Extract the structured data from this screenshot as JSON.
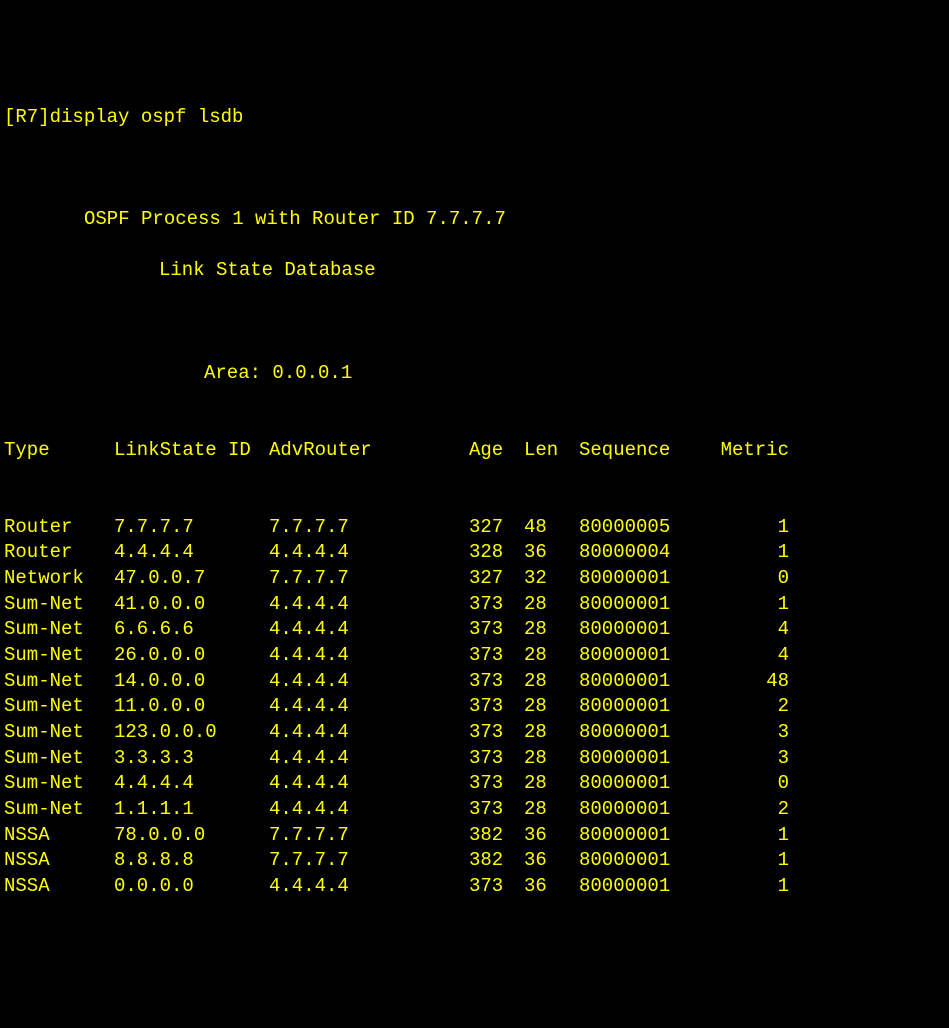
{
  "prompt_line": "[R7]display ospf lsdb",
  "header": {
    "process_line": "OSPF Process 1 with Router ID 7.7.7.7",
    "subtitle": "Link State Database"
  },
  "area_label": "Area: 0.0.0.1",
  "columns": {
    "type": "Type",
    "lsid": "LinkState ID",
    "adv": "AdvRouter",
    "age": "Age",
    "len": "Len",
    "seq": "Sequence",
    "metric": "Metric"
  },
  "rows": [
    {
      "type": "Router",
      "lsid": "7.7.7.7",
      "adv": "7.7.7.7",
      "age": "327",
      "len": "48",
      "seq": "80000005",
      "metric": "1"
    },
    {
      "type": "Router",
      "lsid": "4.4.4.4",
      "adv": "4.4.4.4",
      "age": "328",
      "len": "36",
      "seq": "80000004",
      "metric": "1"
    },
    {
      "type": "Network",
      "lsid": "47.0.0.7",
      "adv": "7.7.7.7",
      "age": "327",
      "len": "32",
      "seq": "80000001",
      "metric": "0"
    },
    {
      "type": "Sum-Net",
      "lsid": "41.0.0.0",
      "adv": "4.4.4.4",
      "age": "373",
      "len": "28",
      "seq": "80000001",
      "metric": "1"
    },
    {
      "type": "Sum-Net",
      "lsid": "6.6.6.6",
      "adv": "4.4.4.4",
      "age": "373",
      "len": "28",
      "seq": "80000001",
      "metric": "4"
    },
    {
      "type": "Sum-Net",
      "lsid": "26.0.0.0",
      "adv": "4.4.4.4",
      "age": "373",
      "len": "28",
      "seq": "80000001",
      "metric": "4"
    },
    {
      "type": "Sum-Net",
      "lsid": "14.0.0.0",
      "adv": "4.4.4.4",
      "age": "373",
      "len": "28",
      "seq": "80000001",
      "metric": "48"
    },
    {
      "type": "Sum-Net",
      "lsid": "11.0.0.0",
      "adv": "4.4.4.4",
      "age": "373",
      "len": "28",
      "seq": "80000001",
      "metric": "2"
    },
    {
      "type": "Sum-Net",
      "lsid": "123.0.0.0",
      "adv": "4.4.4.4",
      "age": "373",
      "len": "28",
      "seq": "80000001",
      "metric": "3"
    },
    {
      "type": "Sum-Net",
      "lsid": "3.3.3.3",
      "adv": "4.4.4.4",
      "age": "373",
      "len": "28",
      "seq": "80000001",
      "metric": "3"
    },
    {
      "type": "Sum-Net",
      "lsid": "4.4.4.4",
      "adv": "4.4.4.4",
      "age": "373",
      "len": "28",
      "seq": "80000001",
      "metric": "0"
    },
    {
      "type": "Sum-Net",
      "lsid": "1.1.1.1",
      "adv": "4.4.4.4",
      "age": "373",
      "len": "28",
      "seq": "80000001",
      "metric": "2"
    },
    {
      "type": "NSSA",
      "lsid": "78.0.0.0",
      "adv": "7.7.7.7",
      "age": "382",
      "len": "36",
      "seq": "80000001",
      "metric": "1"
    },
    {
      "type": "NSSA",
      "lsid": "8.8.8.8",
      "adv": "7.7.7.7",
      "age": "382",
      "len": "36",
      "seq": "80000001",
      "metric": "1"
    },
    {
      "type": "NSSA",
      "lsid": "0.0.0.0",
      "adv": "4.4.4.4",
      "age": "373",
      "len": "36",
      "seq": "80000001",
      "metric": "1"
    }
  ]
}
